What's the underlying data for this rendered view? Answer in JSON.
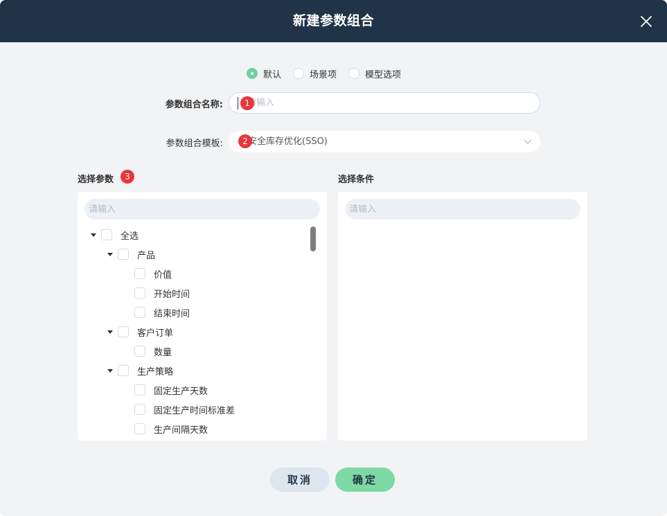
{
  "dialog": {
    "title": "新建参数组合",
    "close_icon": "close-icon"
  },
  "radio": {
    "options": [
      {
        "label": "默认",
        "checked": true
      },
      {
        "label": "场景项",
        "checked": false
      },
      {
        "label": "模型选项",
        "checked": false
      }
    ]
  },
  "form": {
    "name_label": "参数组合名称:",
    "name_placeholder": "请输入",
    "name_value": "",
    "template_label": "参数组合模板:",
    "template_value": "安全库存优化(SSO)"
  },
  "badges": [
    "1",
    "2",
    "3"
  ],
  "params": {
    "title": "选择参数",
    "search_placeholder": "请输入",
    "tree": [
      {
        "label": "全选",
        "level": 0,
        "expandable": true
      },
      {
        "label": "产品",
        "level": 1,
        "expandable": true
      },
      {
        "label": "价值",
        "level": 2,
        "expandable": false
      },
      {
        "label": "开始时间",
        "level": 2,
        "expandable": false
      },
      {
        "label": "结束时间",
        "level": 2,
        "expandable": false
      },
      {
        "label": "客户订单",
        "level": 1,
        "expandable": true
      },
      {
        "label": "数量",
        "level": 2,
        "expandable": false
      },
      {
        "label": "生产策略",
        "level": 1,
        "expandable": true
      },
      {
        "label": "固定生产天数",
        "level": 2,
        "expandable": false
      },
      {
        "label": "固定生产时间标准差",
        "level": 2,
        "expandable": false
      },
      {
        "label": "生产间隔天数",
        "level": 2,
        "expandable": false
      }
    ]
  },
  "conditions": {
    "title": "选择条件",
    "search_placeholder": "请输入"
  },
  "footer": {
    "cancel_label": "取消",
    "ok_label": "确定"
  },
  "colors": {
    "header_bg": "#213346",
    "accent_green": "#7ed9a4",
    "badge_red": "#e8363a"
  }
}
